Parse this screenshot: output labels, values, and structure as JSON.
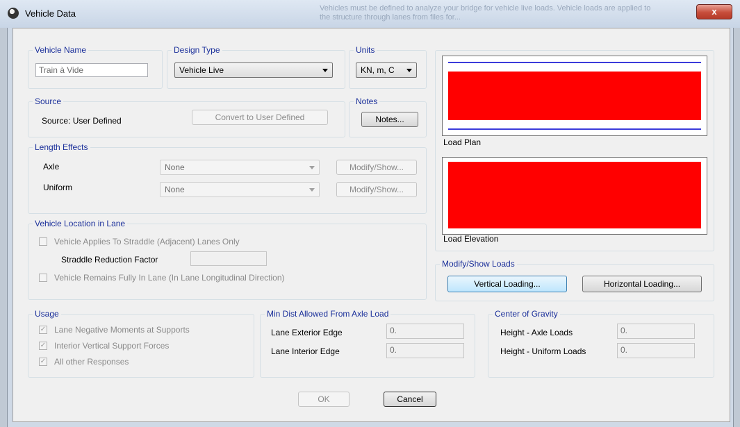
{
  "window": {
    "title": "Vehicle Data",
    "close_glyph": "x",
    "ghost_text": "Vehicles must be defined to analyze your bridge for vehicle live loads. Vehicle loads are applied to the structure through lanes from files for..."
  },
  "vehicle_name": {
    "label": "Vehicle Name",
    "value": "Train à Vide"
  },
  "design_type": {
    "label": "Design Type",
    "value": "Vehicle Live"
  },
  "units": {
    "label": "Units",
    "value": "KN, m, C"
  },
  "source": {
    "label": "Source",
    "text": "Source: User Defined",
    "convert_button": "Convert to User Defined"
  },
  "notes": {
    "label": "Notes",
    "button": "Notes..."
  },
  "length_effects": {
    "label": "Length Effects",
    "axle_label": "Axle",
    "axle_value": "None",
    "axle_button": "Modify/Show...",
    "uniform_label": "Uniform",
    "uniform_value": "None",
    "uniform_button": "Modify/Show..."
  },
  "vehicle_location": {
    "label": "Vehicle Location in Lane",
    "straddle_check": "Vehicle Applies To Straddle (Adjacent) Lanes Only",
    "straddle_factor_label": "Straddle Reduction Factor",
    "fully_in_lane_check": "Vehicle Remains Fully In Lane (In Lane Longitudinal Direction)"
  },
  "previews": {
    "plan_label": "Load Plan",
    "elevation_label": "Load Elevation",
    "load_color": "#ff0000",
    "lane_line_color": "#3b3bdb"
  },
  "modify_loads": {
    "label": "Modify/Show Loads",
    "vertical_button": "Vertical Loading...",
    "horizontal_button": "Horizontal Loading..."
  },
  "usage": {
    "label": "Usage",
    "items": [
      "Lane Negative Moments at Supports",
      "Interior Vertical Support Forces",
      "All other Responses"
    ],
    "check_glyph": "✓"
  },
  "min_dist": {
    "label": "Min Dist Allowed From Axle Load",
    "exterior_label": "Lane Exterior Edge",
    "exterior_value": "0.",
    "interior_label": "Lane Interior Edge",
    "interior_value": "0."
  },
  "center_gravity": {
    "label": "Center of Gravity",
    "axle_label": "Height - Axle Loads",
    "axle_value": "0.",
    "uniform_label": "Height - Uniform Loads",
    "uniform_value": "0."
  },
  "footer": {
    "ok": "OK",
    "cancel": "Cancel"
  }
}
